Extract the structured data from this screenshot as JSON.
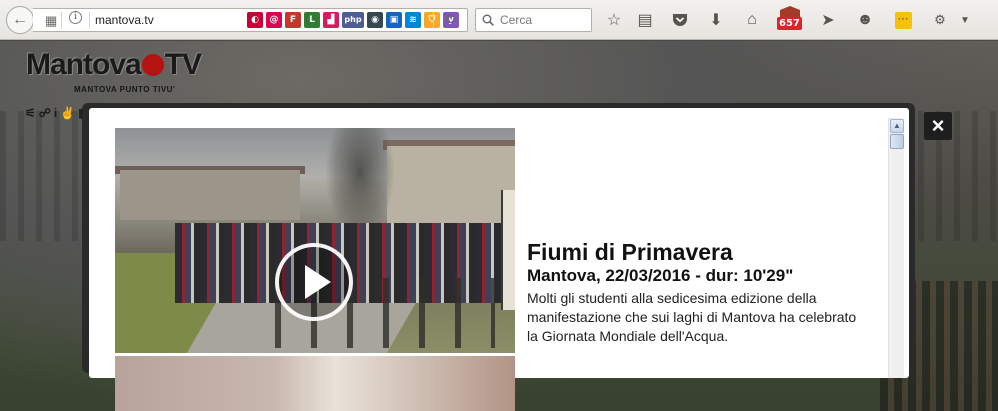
{
  "browser": {
    "url": "mantova.tv",
    "search_placeholder": "Cerca",
    "notification_count": "657",
    "extensions": [
      {
        "name": "debian-icon",
        "glyph": "◐",
        "color": "#c70036"
      },
      {
        "name": "debian-swirl-icon",
        "glyph": "@",
        "color": "#d70751"
      },
      {
        "name": "f-ext-icon",
        "glyph": "F",
        "color": "#c0392b"
      },
      {
        "name": "l-ext-icon",
        "glyph": "L",
        "color": "#2e7d32"
      },
      {
        "name": "pink-ext-icon",
        "glyph": "▟",
        "color": "#d81b60"
      },
      {
        "name": "php-icon",
        "glyph": "php",
        "color": "#4f5b93"
      },
      {
        "name": "eye-ext-icon",
        "glyph": "◉",
        "color": "#37474f"
      },
      {
        "name": "blue-ext-icon",
        "glyph": "▣",
        "color": "#1565c0"
      },
      {
        "name": "wave-ext-icon",
        "glyph": "≋",
        "color": "#0288d1"
      },
      {
        "name": "shield-ext-icon",
        "glyph": "⛉",
        "color": "#f9a825"
      },
      {
        "name": "y-ext-icon",
        "glyph": "y",
        "color": "#7e57c2"
      }
    ]
  },
  "site": {
    "logo_left": "Mantova",
    "logo_right": "TV",
    "logo_sub": "MANTOVA PUNTO TIVU'",
    "accent_color": "#b51212"
  },
  "video": {
    "title": "Fiumi di Primavera",
    "meta": "Mantova, 22/03/2016 - dur: 10'29\"",
    "description": "Molti gli studenti alla sedicesima edizione della manifestazione che sui laghi di Mantova ha celebrato la Giornata Mondiale dell'Acqua."
  },
  "modal": {
    "close_label": "×"
  }
}
